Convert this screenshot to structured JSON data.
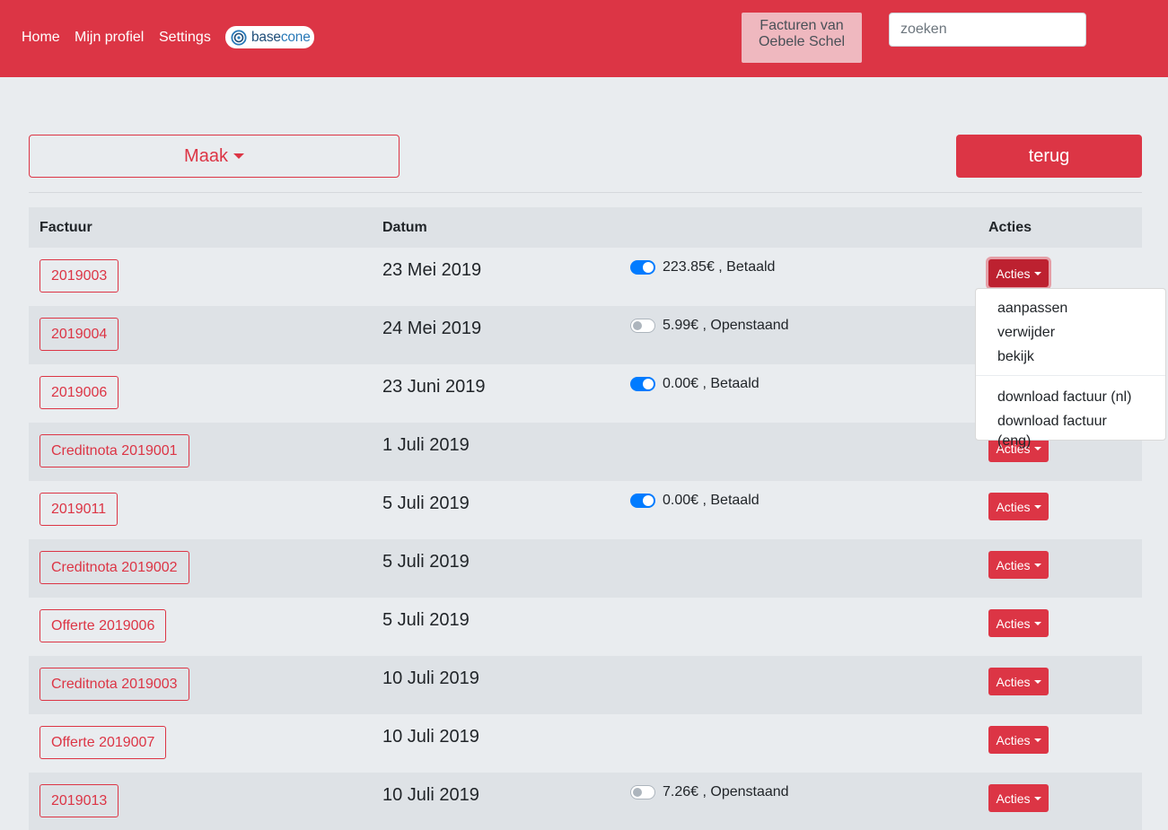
{
  "nav": {
    "home": "Home",
    "profile": "Mijn profiel",
    "settings": "Settings",
    "logo_text_a": "base",
    "logo_text_b": "cone",
    "owner_line1": "Facturen van",
    "owner_line2": "Oebele Schel",
    "search_placeholder": "zoeken"
  },
  "toolbar": {
    "maak_label": "Maak",
    "terug_label": "terug"
  },
  "table": {
    "headers": {
      "invoice": "Factuur",
      "date": "Datum",
      "actions": "Acties"
    },
    "action_label": "Acties",
    "rows": [
      {
        "invoice": "2019003",
        "date": "23 Mei 2019",
        "paid": true,
        "status": "223.85€ , Betaald"
      },
      {
        "invoice": "2019004",
        "date": "24 Mei 2019",
        "paid": false,
        "status": "5.99€ , Openstaand"
      },
      {
        "invoice": "2019006",
        "date": "23 Juni 2019",
        "paid": true,
        "status": "0.00€ , Betaald"
      },
      {
        "invoice": "Creditnota 2019001",
        "date": "1 Juli 2019"
      },
      {
        "invoice": "2019011",
        "date": "5 Juli 2019",
        "paid": true,
        "status": "0.00€ , Betaald"
      },
      {
        "invoice": "Creditnota 2019002",
        "date": "5 Juli 2019"
      },
      {
        "invoice": "Offerte 2019006",
        "date": "5 Juli 2019"
      },
      {
        "invoice": "Creditnota 2019003",
        "date": "10 Juli 2019"
      },
      {
        "invoice": "Offerte 2019007",
        "date": "10 Juli 2019"
      },
      {
        "invoice": "2019013",
        "date": "10 Juli 2019",
        "paid": false,
        "status": "7.26€ , Openstaand"
      }
    ]
  },
  "dropdown": {
    "items": [
      "aanpassen",
      "verwijder",
      "bekijk"
    ],
    "downloads": [
      "download factuur (nl)",
      "download factuur (eng)"
    ]
  },
  "colors": {
    "primary": "#dc3545",
    "toggle_on": "#007bff",
    "background": "#e9ecef",
    "stripe": "#dee2e6"
  }
}
